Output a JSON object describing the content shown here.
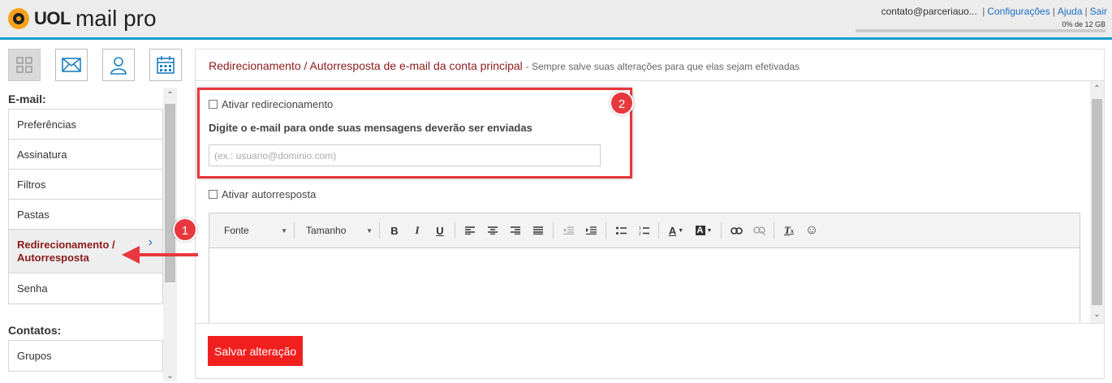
{
  "header": {
    "brand": "UOL",
    "product": "mail pro",
    "user_email": "contato@parceriauo...",
    "links": [
      "Configurações",
      "Ajuda",
      "Sair"
    ],
    "quota": "0% de 12 GB"
  },
  "sidebar": {
    "email_heading": "E-mail:",
    "email_items": [
      {
        "label": "Preferências"
      },
      {
        "label": "Assinatura"
      },
      {
        "label": "Filtros"
      },
      {
        "label": "Pastas"
      },
      {
        "label": "Redirecionamento / Autorresposta",
        "active": true
      },
      {
        "label": "Senha"
      }
    ],
    "contacts_heading": "Contatos:",
    "contacts_items": [
      {
        "label": "Grupos"
      }
    ]
  },
  "main": {
    "title": "Redirecionamento / Autorresposta de e-mail da conta principal",
    "note": "- Sempre salve suas alterações para que elas sejam efetivadas",
    "redirect_checkbox": "Ativar redirecionamento",
    "redirect_label": "Digite o e-mail para onde suas mensagens deverão ser enviadas",
    "redirect_placeholder": "(ex.: usuario@dominio.com)",
    "autoreply_checkbox": "Ativar autorresposta",
    "toolbar": {
      "font": "Fonte",
      "size": "Tamanho"
    },
    "save_label": "Salvar alteração"
  },
  "annotations": {
    "badge1": "1",
    "badge2": "2",
    "color": "#e8383d"
  }
}
